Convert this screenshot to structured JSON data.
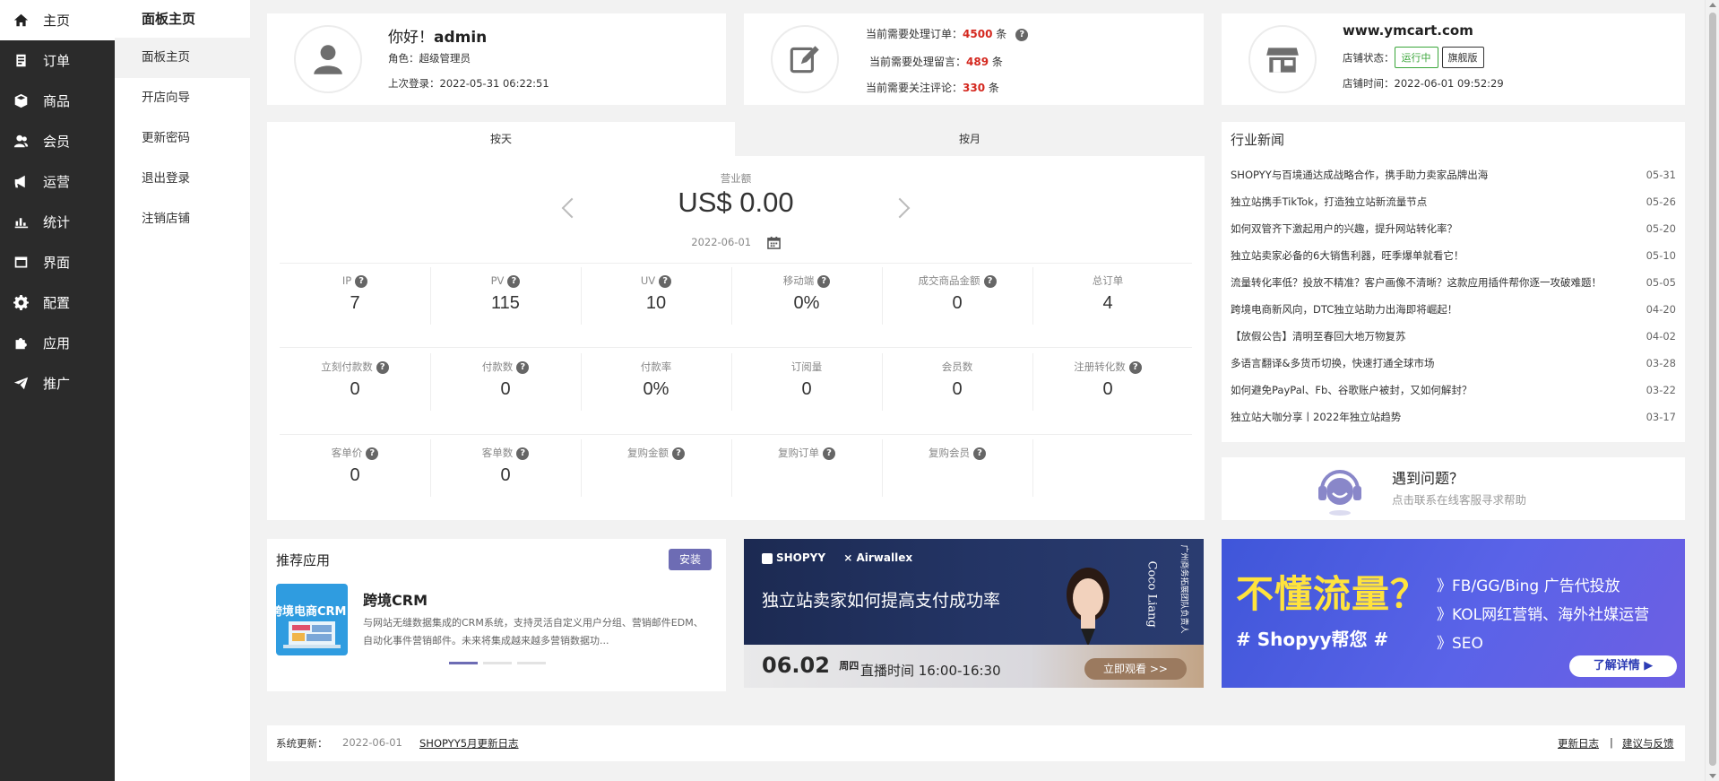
{
  "nav1": [
    {
      "label": "主页",
      "icon": "home-icon"
    },
    {
      "label": "订单",
      "icon": "order-icon"
    },
    {
      "label": "商品",
      "icon": "cube-icon"
    },
    {
      "label": "会员",
      "icon": "users-icon"
    },
    {
      "label": "运营",
      "icon": "megaphone-icon"
    },
    {
      "label": "统计",
      "icon": "bar-chart-icon"
    },
    {
      "label": "界面",
      "icon": "window-icon"
    },
    {
      "label": "配置",
      "icon": "gear-icon"
    },
    {
      "label": "应用",
      "icon": "puzzle-icon"
    },
    {
      "label": "推广",
      "icon": "paper-plane-icon"
    }
  ],
  "nav2": {
    "title": "面板主页",
    "items": [
      "面板主页",
      "开店向导",
      "更新密码",
      "退出登录",
      "注销店铺"
    ]
  },
  "user": {
    "greeting": "你好！",
    "name": "admin",
    "role_label": "角色：",
    "role": "超级管理员",
    "last_login_label": "上次登录：",
    "last_login": "2022-05-31 06:22:51"
  },
  "tasks": {
    "orders_label": "当前需要处理订单：",
    "orders": "4500",
    "messages_label": "当前需要处理留言：",
    "messages": "489",
    "reviews_label": "当前需要关注评论：",
    "reviews": "330",
    "unit": "条",
    "help": "?"
  },
  "store": {
    "domain": "www.ymcart.com",
    "status_label": "店铺状态：",
    "status": "运行中",
    "edition": "旗舰版",
    "time_label": "店铺时间：",
    "time": "2022-06-01 09:52:29"
  },
  "stats": {
    "tabs": [
      "按天",
      "按月"
    ],
    "revenue_label": "营业额",
    "revenue": "US$ 0.00",
    "date": "2022-06-01",
    "rows": [
      [
        {
          "label": "IP",
          "help": true,
          "value": "7"
        },
        {
          "label": "PV",
          "help": true,
          "value": "115"
        },
        {
          "label": "UV",
          "help": true,
          "value": "10"
        },
        {
          "label": "移动端",
          "help": true,
          "value": "0%"
        },
        {
          "label": "成交商品金额",
          "help": true,
          "value": "0"
        },
        {
          "label": "总订单",
          "help": false,
          "value": "4"
        }
      ],
      [
        {
          "label": "立刻付款数",
          "help": true,
          "value": "0"
        },
        {
          "label": "付款数",
          "help": true,
          "value": "0"
        },
        {
          "label": "付款率",
          "help": false,
          "value": "0%"
        },
        {
          "label": "订阅量",
          "help": false,
          "value": "0"
        },
        {
          "label": "会员数",
          "help": false,
          "value": "0"
        },
        {
          "label": "注册转化数",
          "help": true,
          "value": "0"
        }
      ],
      [
        {
          "label": "客单价",
          "help": true,
          "value": "0"
        },
        {
          "label": "客单数",
          "help": true,
          "value": "0"
        },
        {
          "label": "复购金额",
          "help": true,
          "value": ""
        },
        {
          "label": "复购订单",
          "help": true,
          "value": ""
        },
        {
          "label": "复购会员",
          "help": true,
          "value": ""
        }
      ]
    ]
  },
  "news": {
    "title": "行业新闻",
    "items": [
      {
        "title": "SHOPYY与百境通达成战略合作，携手助力卖家品牌出海",
        "date": "05-31"
      },
      {
        "title": "独立站携手TikTok，打造独立站新流量节点",
        "date": "05-26"
      },
      {
        "title": "如何双管齐下激起用户的兴趣，提升网站转化率？",
        "date": "05-20"
      },
      {
        "title": "独立站卖家必备的6大销售利器，旺季爆单就看它！",
        "date": "05-10"
      },
      {
        "title": "流量转化率低？投放不精准？客户画像不清晰？这款应用插件帮你逐一攻破难题！",
        "date": "05-05"
      },
      {
        "title": "跨境电商新风向，DTC独立站助力出海即将崛起！",
        "date": "04-20"
      },
      {
        "title": "【放假公告】清明至春回大地万物复苏",
        "date": "04-02"
      },
      {
        "title": "多语言翻译&多货币切换，快速打通全球市场",
        "date": "03-28"
      },
      {
        "title": "如何避免PayPal、Fb、谷歌账户被封，又如何解封？",
        "date": "03-22"
      },
      {
        "title": "独立站大咖分享丨2022年独立站趋势",
        "date": "03-17"
      }
    ]
  },
  "help": {
    "title": "遇到问题？",
    "subtitle": "点击联系在线客服寻求帮助"
  },
  "recommended": {
    "title": "推荐应用",
    "install": "安装",
    "app_name": "跨境CRM",
    "app_thumb_text": "跨境电商CRM",
    "app_desc": "与网站无缝数据集成的CRM系统，支持灵活自定义用户分组、营销邮件EDM、自动化事件营销邮件。未来将集成越来越多营销数据功..."
  },
  "banner1": {
    "brand1": "SHOPYY",
    "brand2": "Airwallex",
    "headline": "独立站卖家如何提高支付成功率",
    "date": "06.02",
    "weekday": "周四",
    "live_time": "直播时间 16:00-16:30",
    "watch": "立即观看 >>",
    "speaker": "Coco Liang",
    "speaker_title": "广州商务拓展团队负责人"
  },
  "banner2": {
    "headline": "不懂流量？",
    "tagline": "# Shopyy帮您 #",
    "lines": [
      "》FB/GG/Bing 广告代投放",
      "》KOL网红营销、海外社媒运营",
      "》SEO"
    ],
    "cta": "了解详情 ▶"
  },
  "footer": {
    "label": "系统更新：",
    "date": "2022-06-01",
    "log_link": "SHOPYY5月更新日志",
    "changelog": "更新日志",
    "sep": "|",
    "feedback": "建议与反馈"
  },
  "colors": {
    "accent": "#6d6cb4",
    "danger": "#d4281f",
    "success": "#3aa53a",
    "sidebar": "#2b2b2b"
  }
}
